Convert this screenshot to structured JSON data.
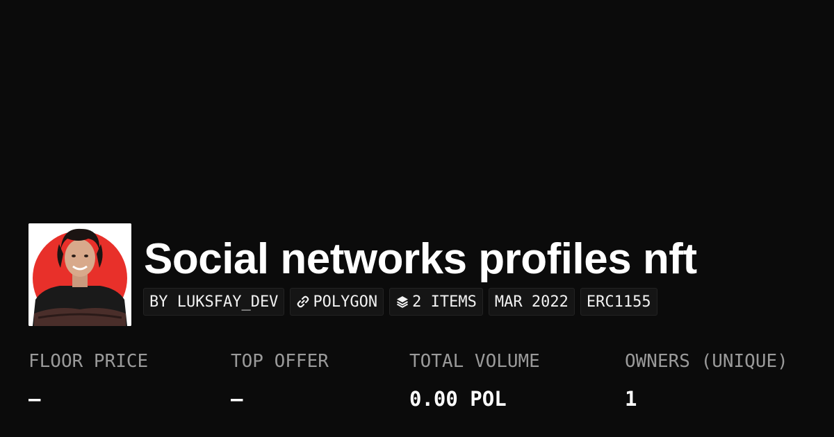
{
  "collection": {
    "title": "Social networks profiles nft",
    "avatar_icon": "profile-photo",
    "accent_color": "#e8302a",
    "tags": [
      {
        "text": "BY LUKSFAY_DEV"
      },
      {
        "text": "POLYGON",
        "icon": "link-icon"
      },
      {
        "text": "2 ITEMS",
        "icon": "layers-icon"
      },
      {
        "text": "MAR 2022"
      },
      {
        "text": "ERC1155"
      }
    ]
  },
  "stats": [
    {
      "label": "FLOOR PRICE",
      "value": "–"
    },
    {
      "label": "TOP OFFER",
      "value": "–"
    },
    {
      "label": "TOTAL VOLUME",
      "value": "0.00 POL"
    },
    {
      "label": "OWNERS (UNIQUE)",
      "value": "1"
    }
  ]
}
